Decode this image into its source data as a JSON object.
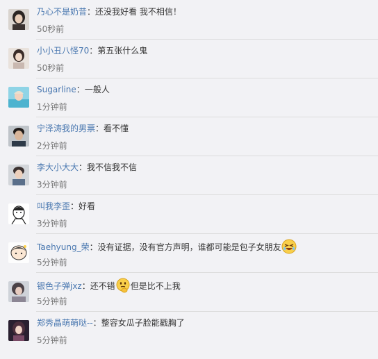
{
  "comments": [
    {
      "name": "乃心不是奶昔",
      "text": "还没我好看 我不相信！",
      "time": "50秒前"
    },
    {
      "name": "小小丑八怪70",
      "text": "第五张什么鬼",
      "time": "50秒前"
    },
    {
      "name": "Sugarline",
      "text": "一般人",
      "time": "1分钟前"
    },
    {
      "name": "宁泽涛我的男票",
      "text": "看不懂",
      "time": "2分钟前"
    },
    {
      "name": "李大小大大",
      "text": "我不信我不信",
      "time": "3分钟前"
    },
    {
      "name": "叫我李歪",
      "text": "好看",
      "time": "3分钟前"
    },
    {
      "name": "Taehyung_荣",
      "text": "没有证据，没有官方声明，谁都可能是包子女朋友",
      "time": "5分钟前",
      "emoji": "laughing-emoji"
    },
    {
      "name": "银色子弹jxz",
      "text_before": "还不错",
      "text_after": "但是比不上我",
      "time": "5分钟前",
      "emoji": "thinking-emoji"
    },
    {
      "name": "郑秀晶萌萌哒--",
      "text": "整容女瓜子脸能戳胸了",
      "time": "5分钟前"
    }
  ],
  "separator": "："
}
